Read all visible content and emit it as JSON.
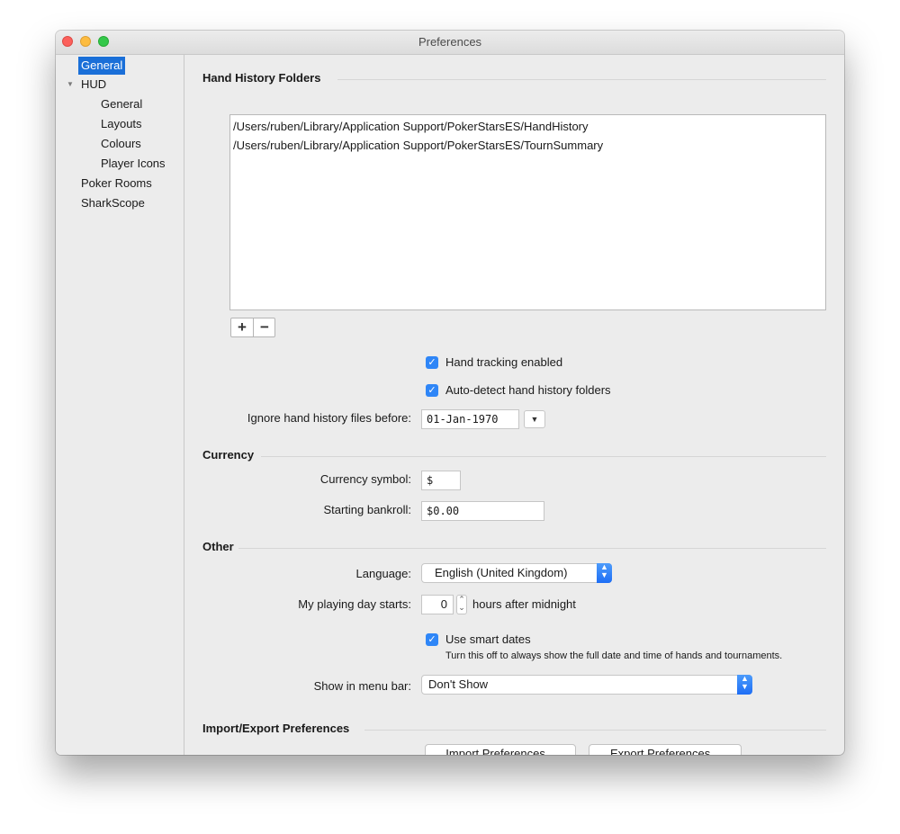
{
  "window": {
    "title": "Preferences"
  },
  "sidebar": {
    "items": [
      {
        "label": "General",
        "selected": true
      },
      {
        "label": "HUD",
        "expanded": true
      },
      {
        "label": "General"
      },
      {
        "label": "Layouts"
      },
      {
        "label": "Colours"
      },
      {
        "label": "Player Icons"
      },
      {
        "label": "Poker Rooms"
      },
      {
        "label": "SharkScope"
      }
    ]
  },
  "hand_history": {
    "heading": "Hand History Folders",
    "folders": [
      "/Users/ruben/Library/Application Support/PokerStarsES/HandHistory",
      "/Users/ruben/Library/Application Support/PokerStarsES/TournSummary"
    ],
    "add_symbol": "+",
    "remove_symbol": "−",
    "tracking_label": "Hand tracking enabled",
    "tracking_checked": true,
    "autodetect_label": "Auto-detect hand history folders",
    "autodetect_checked": true,
    "ignore_label": "Ignore hand history files before:",
    "ignore_date": "01-Jan-1970"
  },
  "currency": {
    "heading": "Currency",
    "symbol_label": "Currency symbol:",
    "symbol_value": "$",
    "bankroll_label": "Starting bankroll:",
    "bankroll_value": "$0.00"
  },
  "other": {
    "heading": "Other",
    "language_label": "Language:",
    "language_value": "English (United Kingdom)",
    "day_start_label": "My playing day starts:",
    "day_start_value": "0",
    "day_start_suffix": "hours after midnight",
    "smart_dates_label": "Use smart dates",
    "smart_dates_checked": true,
    "smart_dates_note": "Turn this off to always show the full date and time of hands and tournaments.",
    "menubar_label": "Show in menu bar:",
    "menubar_value": "Don't Show"
  },
  "import_export": {
    "heading": "Import/Export Preferences",
    "import_label": "Import Preferences...",
    "export_label": "Export Preferences..."
  },
  "colors": {
    "accent": "#2f86f7",
    "selection": "#1a6fd8"
  }
}
